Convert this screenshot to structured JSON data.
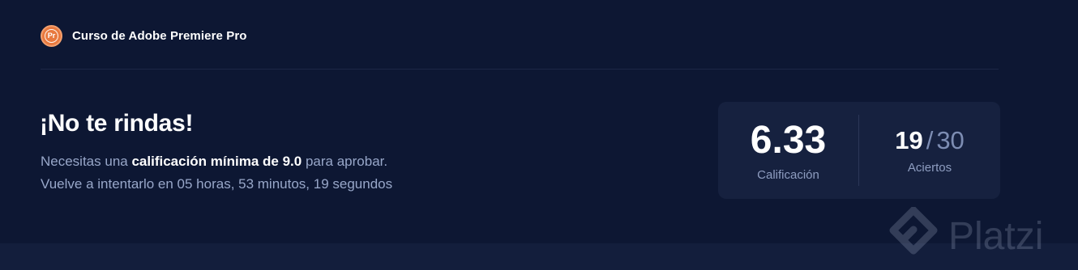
{
  "header": {
    "course_badge": "Pr",
    "course_title": "Curso de Adobe Premiere Pro"
  },
  "result": {
    "heading": "¡No te rindas!",
    "line1_prefix": "Necesitas una",
    "line1_bold": "calificación mínima de 9.0",
    "line1_suffix": "para aprobar.",
    "line2": "Vuelve a intentarlo en 05 horas, 53 minutos, 19 segundos"
  },
  "score": {
    "grade_value": "6.33",
    "grade_label": "Calificación",
    "hits_value": "19",
    "hits_separator": "/",
    "hits_total": "30",
    "hits_label": "Aciertos"
  },
  "watermark": {
    "text": "Platzi"
  },
  "colors": {
    "background": "#0d1733",
    "card": "#16213f",
    "badge": "#e8793f",
    "muted_text": "#98a7c9"
  },
  "icons": {
    "course_badge": "premiere-pro-badge-icon",
    "watermark_logo": "platzi-logo-icon"
  }
}
